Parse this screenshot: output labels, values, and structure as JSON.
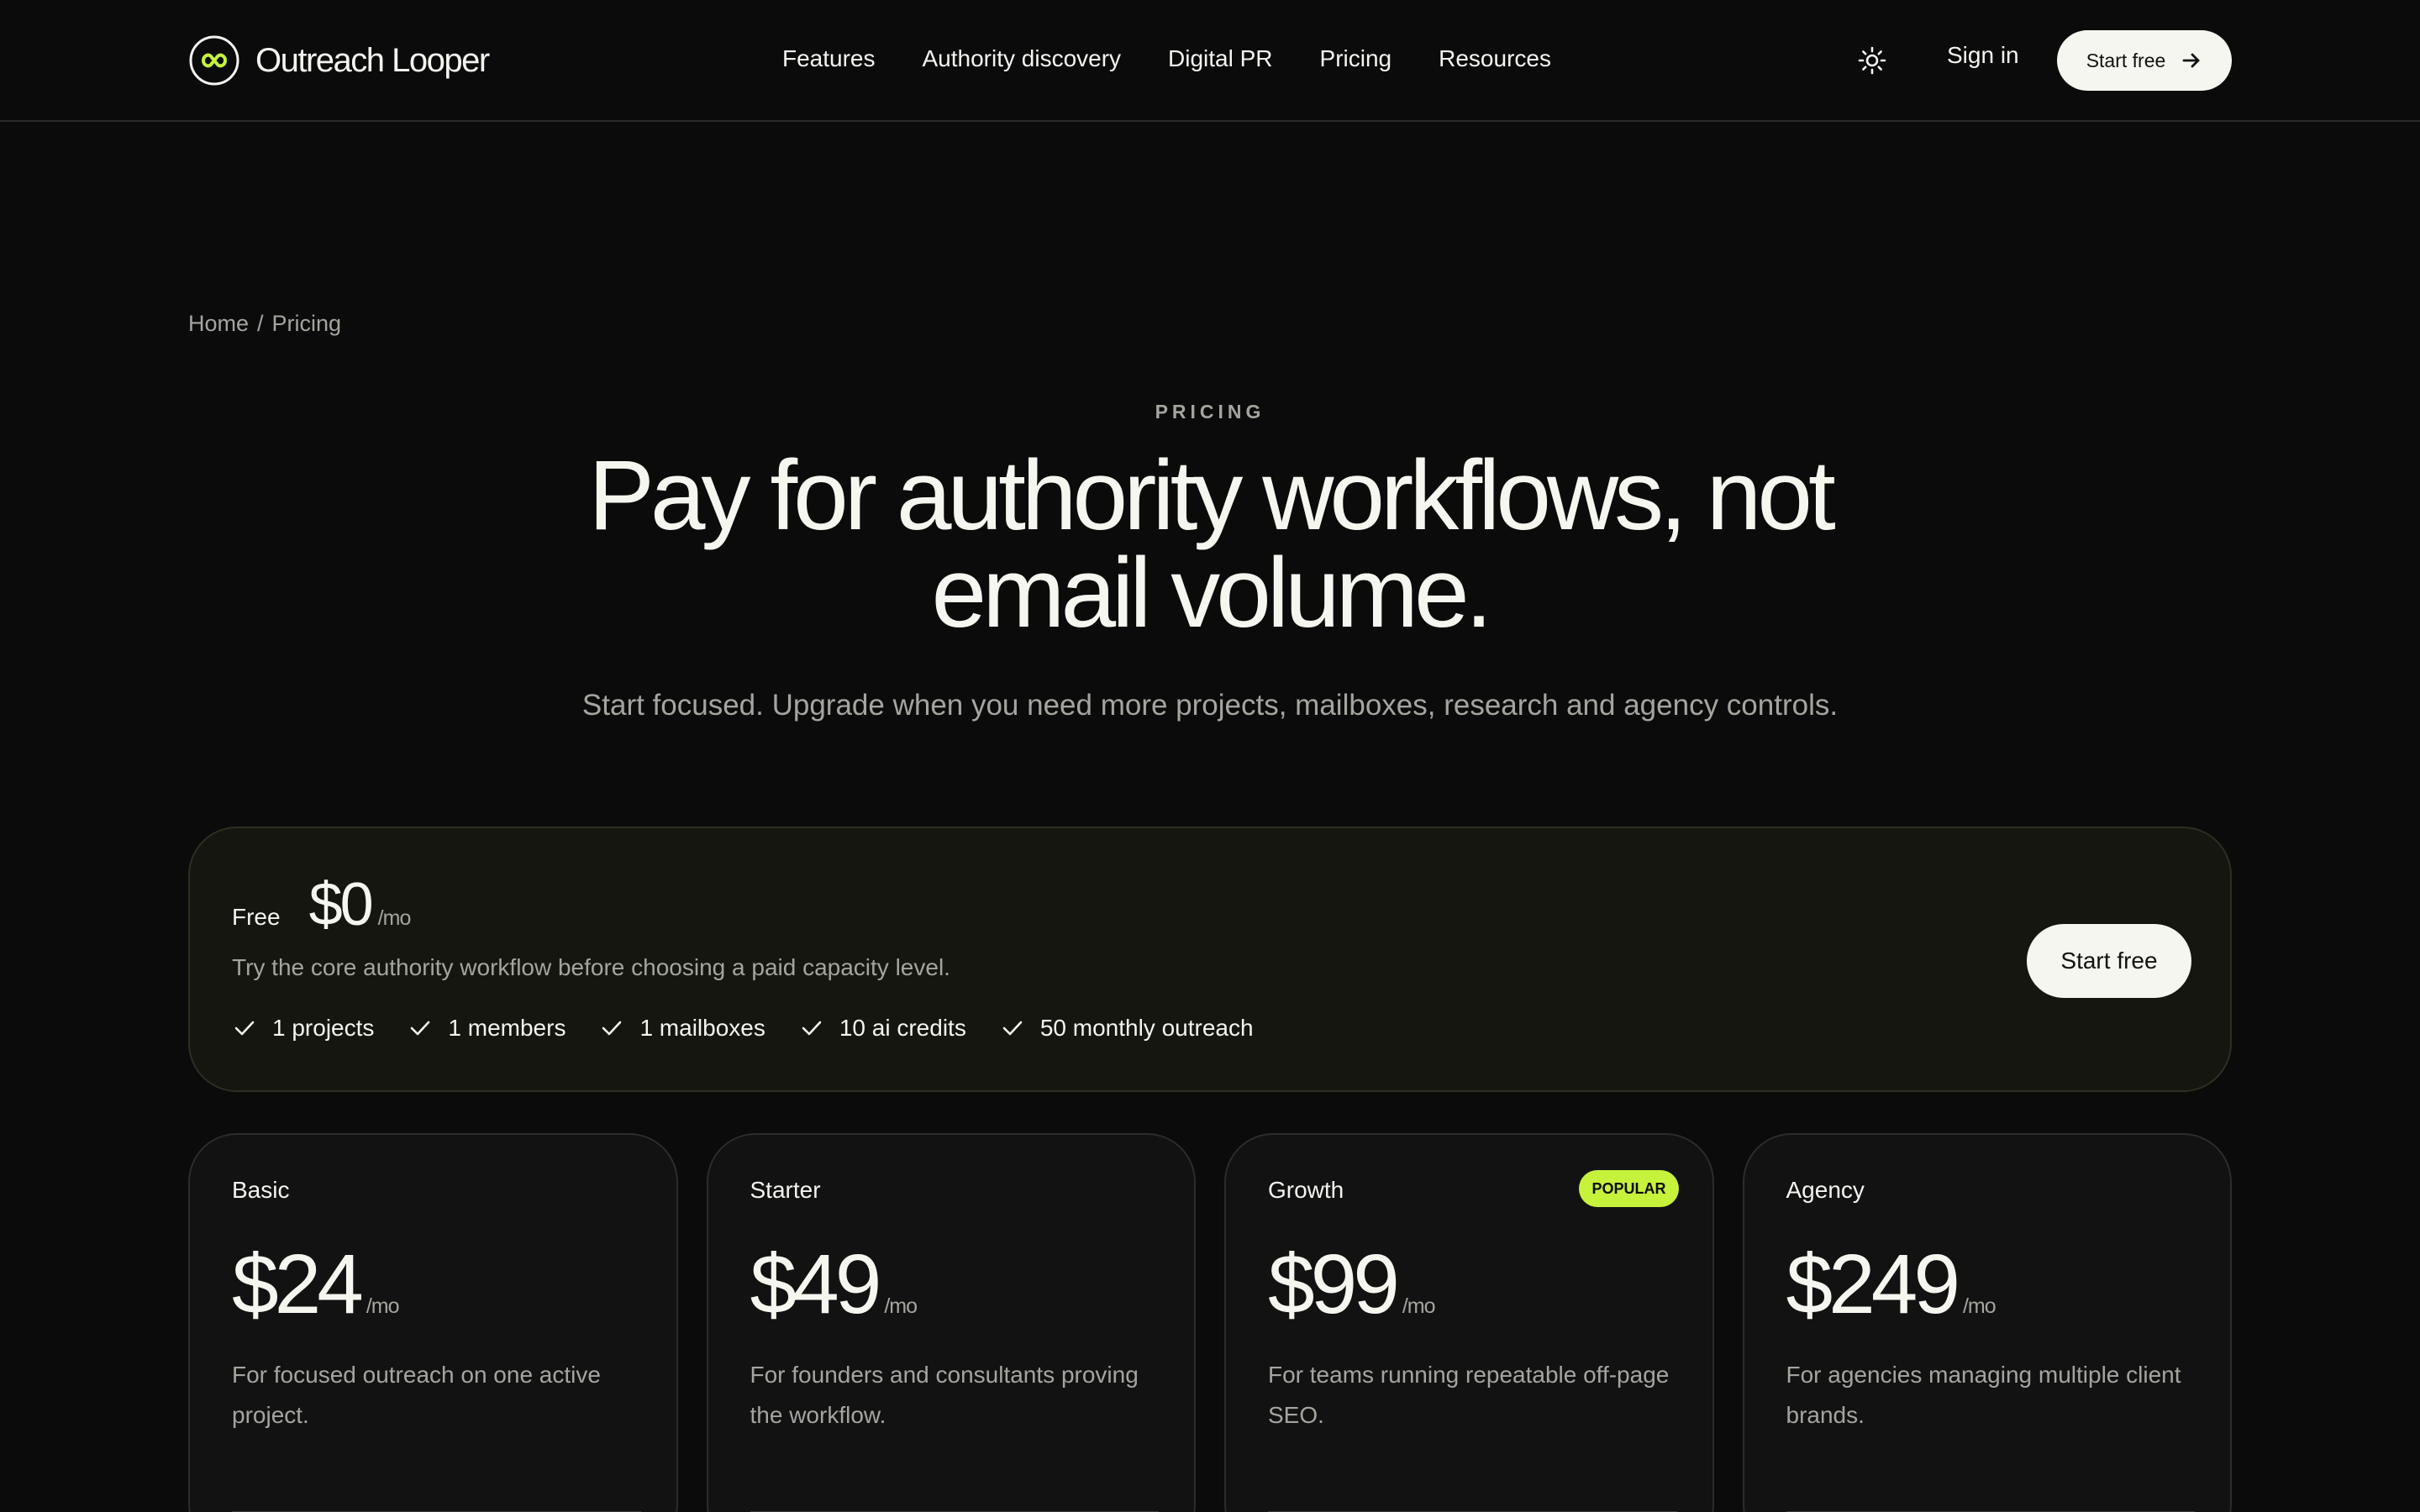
{
  "header": {
    "logo_text": "Outreach Looper",
    "nav": [
      "Features",
      "Authority discovery",
      "Digital PR",
      "Pricing",
      "Resources"
    ],
    "sign_in": "Sign in",
    "cta": "Start free"
  },
  "breadcrumb": {
    "home": "Home",
    "separator": "/",
    "current": "Pricing"
  },
  "hero": {
    "eyebrow": "PRICING",
    "title_line1": "Pay for authority workflows, not",
    "title_line2": "email volume.",
    "subtitle": "Start focused. Upgrade when you need more projects, mailboxes, research and agency controls."
  },
  "free_plan": {
    "name": "Free",
    "price": "$0",
    "per": "/mo",
    "description": "Try the core authority workflow before choosing a paid capacity level.",
    "features": [
      "1 projects",
      "1 members",
      "1 mailboxes",
      "10 ai credits",
      "50 monthly outreach"
    ],
    "cta": "Start free"
  },
  "plans": [
    {
      "name": "Basic",
      "price": "$24",
      "per": "/mo",
      "description": "For focused outreach on one active project.",
      "badge": ""
    },
    {
      "name": "Starter",
      "price": "$49",
      "per": "/mo",
      "description": "For founders and consultants proving the workflow.",
      "badge": ""
    },
    {
      "name": "Growth",
      "price": "$99",
      "per": "/mo",
      "description": "For teams running repeatable off-page SEO.",
      "badge": "POPULAR"
    },
    {
      "name": "Agency",
      "price": "$249",
      "per": "/mo",
      "description": "For agencies managing multiple client brands.",
      "badge": ""
    }
  ],
  "colors": {
    "background": "#0b0b0b",
    "accent": "#c7f23c",
    "button": "#f6f6f0",
    "muted_text": "#a5a5a0"
  },
  "icons": {
    "logo": "infinity-loop-icon",
    "theme_toggle": "sun-icon",
    "cta_arrow": "arrow-right-icon",
    "feature_check": "check-icon"
  }
}
